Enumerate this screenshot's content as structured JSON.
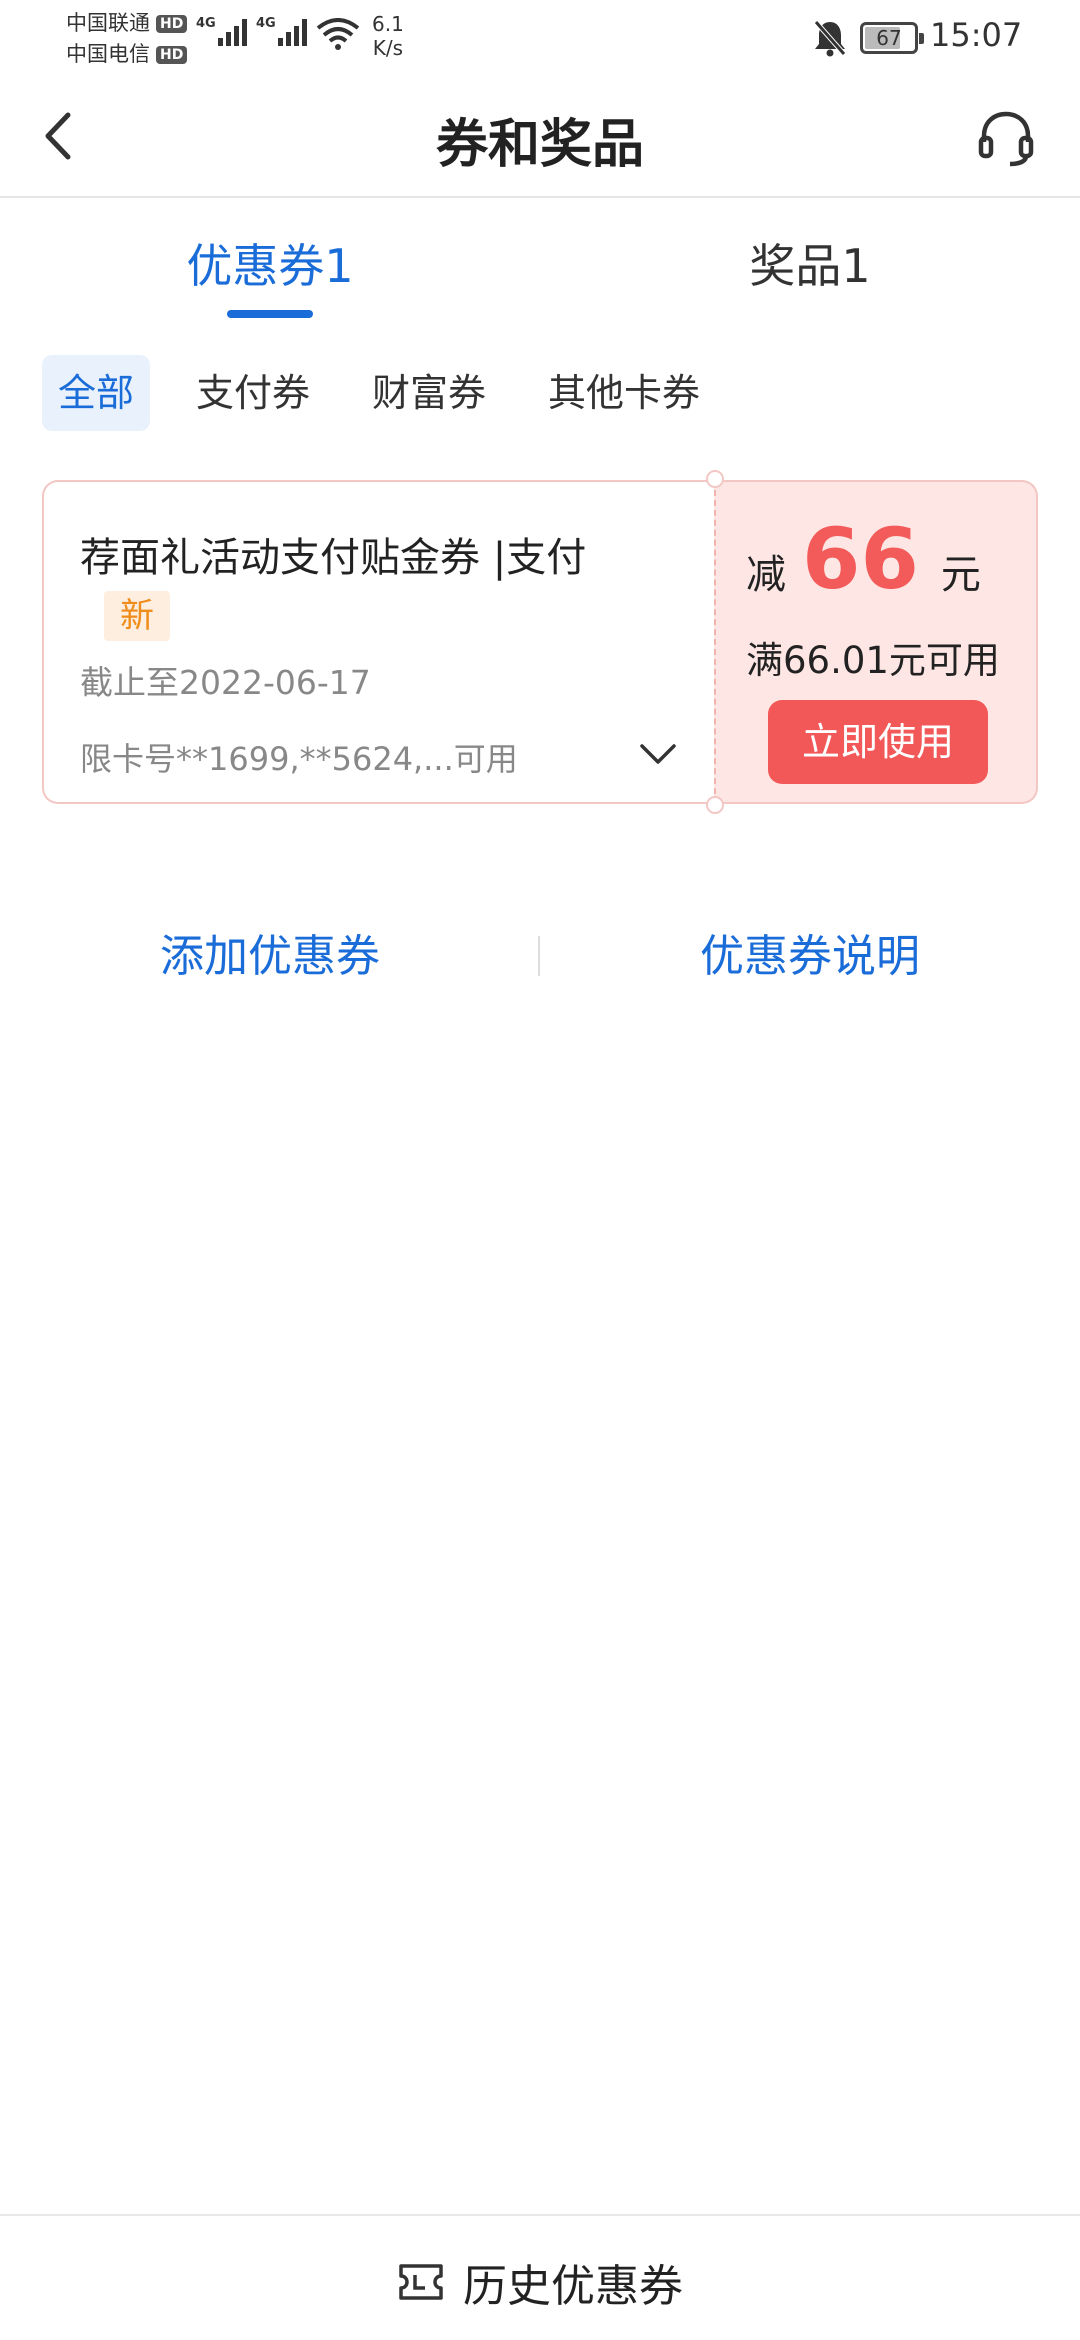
{
  "status_bar": {
    "carrier1": "中国联通",
    "carrier2": "中国电信",
    "hd_label": "HD",
    "network_type": "4G",
    "net_speed_value": "6.1",
    "net_speed_unit": "K/s",
    "battery_level": "67",
    "time": "15:07"
  },
  "header": {
    "title": "券和奖品"
  },
  "tabs": [
    {
      "label": "优惠券1",
      "active": true
    },
    {
      "label": "奖品1",
      "active": false
    }
  ],
  "filters": [
    "全部",
    "支付券",
    "财富券",
    "其他卡券"
  ],
  "coupon": {
    "name": "荐面礼活动支付贴金券 |支付",
    "badge": "新",
    "expiry": "截止至2022-06-17",
    "cards": "限卡号**1699,**5624,...可用",
    "discount_prefix": "减",
    "discount_amount": "66",
    "discount_unit": "元",
    "threshold": "满66.01元可用",
    "use_button": "立即使用"
  },
  "links": {
    "add": "添加优惠券",
    "description": "优惠券说明"
  },
  "bottom": {
    "history_label": "历史优惠券"
  },
  "colors": {
    "accent": "#1a6cd8",
    "coupon_red": "#f25858",
    "coupon_bg": "#fde6e4",
    "badge_orange": "#f08c1a"
  }
}
